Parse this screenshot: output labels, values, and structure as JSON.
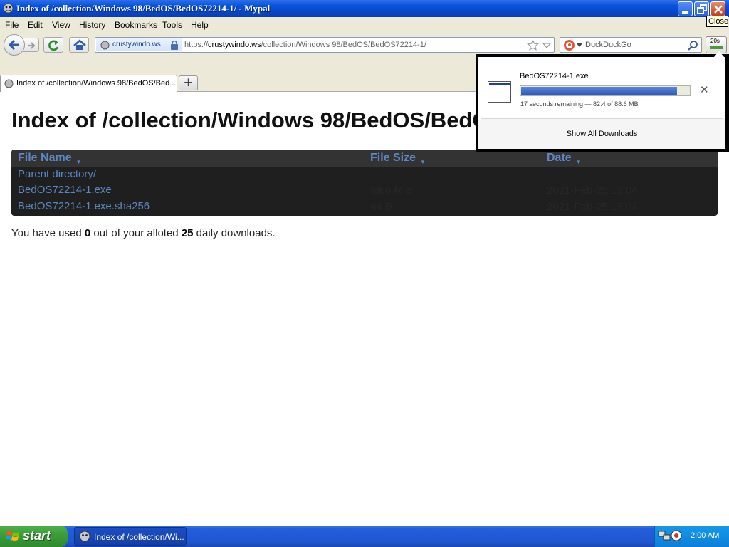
{
  "window": {
    "title": "Index of /collection/Windows 98/BedOS/BedOS72214-1/ - Mypal",
    "close_tooltip": "Close"
  },
  "menu": [
    "File",
    "Edit",
    "View",
    "History",
    "Bookmarks",
    "Tools",
    "Help"
  ],
  "navbar": {
    "identity_site": "crustywindo.ws",
    "url_scheme": "https://",
    "url_host": "crustywindo.ws",
    "url_path": "/collection/Windows 98/BedOS/BedOS72214-1/",
    "search_engine": "DuckDuckGo",
    "download_indicator_text": "20s"
  },
  "tab": {
    "label": "Index of /collection/Windows 98/BedOS/Bed...",
    "new_tab": "+"
  },
  "page": {
    "heading": "Index of /collection/Windows 98/BedOS/BedOS72214-1/",
    "columns": [
      "File Name",
      "File Size",
      "Date"
    ],
    "rows": [
      {
        "name": "Parent directory/",
        "size": "",
        "date": ""
      },
      {
        "name": "BedOS72214-1.exe",
        "size": "88.6 MiB",
        "date": "2021-Feb-25 13:04"
      },
      {
        "name": "BedOS72214-1.exe.sha256",
        "size": "84 B",
        "date": "2021-Feb-25 13:04"
      }
    ],
    "usage_prefix": "You have used",
    "usage_used": "0",
    "usage_middle": "out of your alloted",
    "usage_total": "25",
    "usage_suffix": "daily downloads."
  },
  "downloads_panel": {
    "file_name": "BedOS72214-1.exe",
    "progress_fraction": 0.93,
    "status": "17 seconds remaining — 82.4 of 88.6 MB",
    "show_all": "Show All Downloads"
  },
  "taskbar": {
    "start_label": "start",
    "task_label": "Index of /collection/Wi...",
    "clock": "2:00 AM"
  },
  "colors": {
    "link": "#5b87c4",
    "table_bg": "#1f1f1f",
    "titlebar": "#0a55dd"
  }
}
